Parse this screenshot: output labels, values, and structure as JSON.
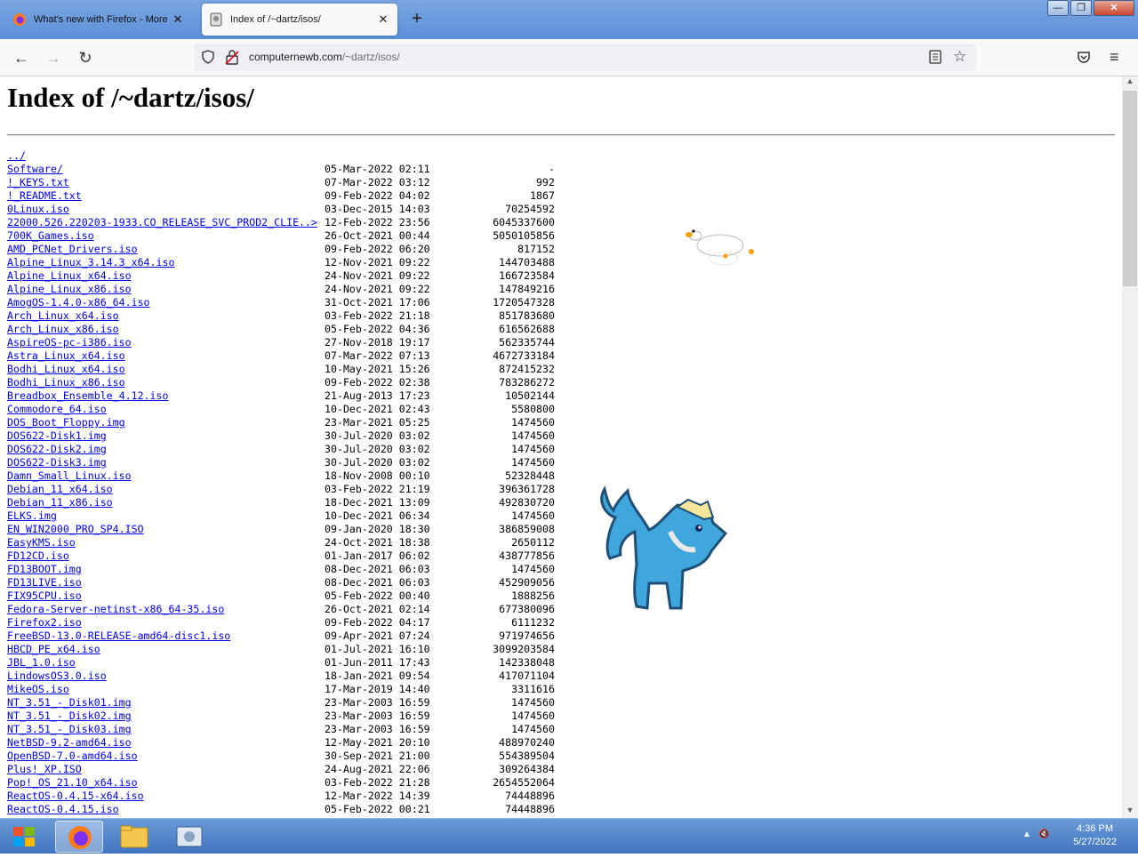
{
  "tabs": [
    {
      "title": "What's new with Firefox - More privac...",
      "active": false
    },
    {
      "title": "Index of /~dartz/isos/",
      "active": true
    }
  ],
  "window_buttons": {
    "minimize": "—",
    "maximize": "❐",
    "close": "✕"
  },
  "url": {
    "host": "computernewb.com",
    "path": "/~dartz/isos/"
  },
  "page": {
    "heading": "Index of /~dartz/isos/"
  },
  "listing": [
    {
      "name": "../",
      "date": "",
      "size": ""
    },
    {
      "name": "Software/",
      "date": "05-Mar-2022 02:11",
      "size": "-"
    },
    {
      "name": "!_KEYS.txt",
      "date": "07-Mar-2022 03:12",
      "size": "992"
    },
    {
      "name": "!_README.txt",
      "date": "09-Feb-2022 04:02",
      "size": "1867"
    },
    {
      "name": "0Linux.iso",
      "date": "03-Dec-2015 14:03",
      "size": "70254592"
    },
    {
      "name": "22000.526.220203-1933.CO_RELEASE_SVC_PROD2_CLIE..>",
      "date": "12-Feb-2022 23:56",
      "size": "6045337600"
    },
    {
      "name": "700K_Games.iso",
      "date": "26-Oct-2021 00:44",
      "size": "5050105856"
    },
    {
      "name": "AMD_PCNet_Drivers.iso",
      "date": "09-Feb-2022 06:20",
      "size": "817152"
    },
    {
      "name": "Alpine_Linux_3.14.3_x64.iso",
      "date": "12-Nov-2021 09:22",
      "size": "144703488"
    },
    {
      "name": "Alpine_Linux_x64.iso",
      "date": "24-Nov-2021 09:22",
      "size": "166723584"
    },
    {
      "name": "Alpine_Linux_x86.iso",
      "date": "24-Nov-2021 09:22",
      "size": "147849216"
    },
    {
      "name": "AmogOS-1.4.0-x86_64.iso",
      "date": "31-Oct-2021 17:06",
      "size": "1720547328"
    },
    {
      "name": "Arch_Linux_x64.iso",
      "date": "03-Feb-2022 21:18",
      "size": "851783680"
    },
    {
      "name": "Arch_Linux_x86.iso",
      "date": "05-Feb-2022 04:36",
      "size": "616562688"
    },
    {
      "name": "AspireOS-pc-i386.iso",
      "date": "27-Nov-2018 19:17",
      "size": "562335744"
    },
    {
      "name": "Astra_Linux_x64.iso",
      "date": "07-Mar-2022 07:13",
      "size": "4672733184"
    },
    {
      "name": "Bodhi_Linux_x64.iso",
      "date": "10-May-2021 15:26",
      "size": "872415232"
    },
    {
      "name": "Bodhi_Linux_x86.iso",
      "date": "09-Feb-2022 02:38",
      "size": "783286272"
    },
    {
      "name": "Breadbox_Ensemble_4.12.iso",
      "date": "21-Aug-2013 17:23",
      "size": "10502144"
    },
    {
      "name": "Commodore_64.iso",
      "date": "10-Dec-2021 02:43",
      "size": "5580800"
    },
    {
      "name": "DOS_Boot_Floppy.img",
      "date": "23-Mar-2021 05:25",
      "size": "1474560"
    },
    {
      "name": "DOS622-Disk1.img",
      "date": "30-Jul-2020 03:02",
      "size": "1474560"
    },
    {
      "name": "DOS622-Disk2.img",
      "date": "30-Jul-2020 03:02",
      "size": "1474560"
    },
    {
      "name": "DOS622-Disk3.img",
      "date": "30-Jul-2020 03:02",
      "size": "1474560"
    },
    {
      "name": "Damn_Small_Linux.iso",
      "date": "18-Nov-2008 00:10",
      "size": "52328448"
    },
    {
      "name": "Debian_11_x64.iso",
      "date": "03-Feb-2022 21:19",
      "size": "396361728"
    },
    {
      "name": "Debian_11_x86.iso",
      "date": "18-Dec-2021 13:09",
      "size": "492830720"
    },
    {
      "name": "ELKS.img",
      "date": "10-Dec-2021 06:34",
      "size": "1474560"
    },
    {
      "name": "EN_WIN2000_PRO_SP4.ISO",
      "date": "09-Jan-2020 18:30",
      "size": "386859008"
    },
    {
      "name": "EasyKMS.iso",
      "date": "24-Oct-2021 18:38",
      "size": "2650112"
    },
    {
      "name": "FD12CD.iso",
      "date": "01-Jan-2017 06:02",
      "size": "438777856"
    },
    {
      "name": "FD13BOOT.img",
      "date": "08-Dec-2021 06:03",
      "size": "1474560"
    },
    {
      "name": "FD13LIVE.iso",
      "date": "08-Dec-2021 06:03",
      "size": "452909056"
    },
    {
      "name": "FIX95CPU.iso",
      "date": "05-Feb-2022 00:40",
      "size": "1888256"
    },
    {
      "name": "Fedora-Server-netinst-x86_64-35.iso",
      "date": "26-Oct-2021 02:14",
      "size": "677380096"
    },
    {
      "name": "Firefox2.iso",
      "date": "09-Feb-2022 04:17",
      "size": "6111232"
    },
    {
      "name": "FreeBSD-13.0-RELEASE-amd64-disc1.iso",
      "date": "09-Apr-2021 07:24",
      "size": "971974656"
    },
    {
      "name": "HBCD_PE_x64.iso",
      "date": "01-Jul-2021 16:10",
      "size": "3099203584"
    },
    {
      "name": "JBL_1.0.iso",
      "date": "01-Jun-2011 17:43",
      "size": "142338048"
    },
    {
      "name": "LindowsOS3.0.iso",
      "date": "18-Jan-2021 09:54",
      "size": "417071104"
    },
    {
      "name": "MikeOS.iso",
      "date": "17-Mar-2019 14:40",
      "size": "3311616"
    },
    {
      "name": "NT_3.51_-_Disk01.img",
      "date": "23-Mar-2003 16:59",
      "size": "1474560"
    },
    {
      "name": "NT_3.51_-_Disk02.img",
      "date": "23-Mar-2003 16:59",
      "size": "1474560"
    },
    {
      "name": "NT_3.51_-_Disk03.img",
      "date": "23-Mar-2003 16:59",
      "size": "1474560"
    },
    {
      "name": "NetBSD-9.2-amd64.iso",
      "date": "12-May-2021 20:10",
      "size": "488970240"
    },
    {
      "name": "OpenBSD-7.0-amd64.iso",
      "date": "30-Sep-2021 21:00",
      "size": "554389504"
    },
    {
      "name": "Plus!_XP.ISO",
      "date": "24-Aug-2021 22:06",
      "size": "309264384"
    },
    {
      "name": "Pop!_OS_21.10_x64.iso",
      "date": "03-Feb-2022 21:28",
      "size": "2654552064"
    },
    {
      "name": "ReactOS-0.4.15-x64.iso",
      "date": "12-Mar-2022 14:39",
      "size": "74448896"
    },
    {
      "name": "ReactOS-0.4.15.iso",
      "date": "05-Feb-2022 00:21",
      "size": "74448896"
    }
  ],
  "taskbar": {
    "time": "4:36 PM",
    "date": "5/27/2022",
    "apps": [
      "firefox",
      "file-explorer",
      "control-panel"
    ]
  },
  "icons": {
    "back": "back-arrow-icon",
    "forward": "forward-arrow-icon",
    "reload": "reload-icon",
    "menu": "hamburger-menu-icon"
  }
}
